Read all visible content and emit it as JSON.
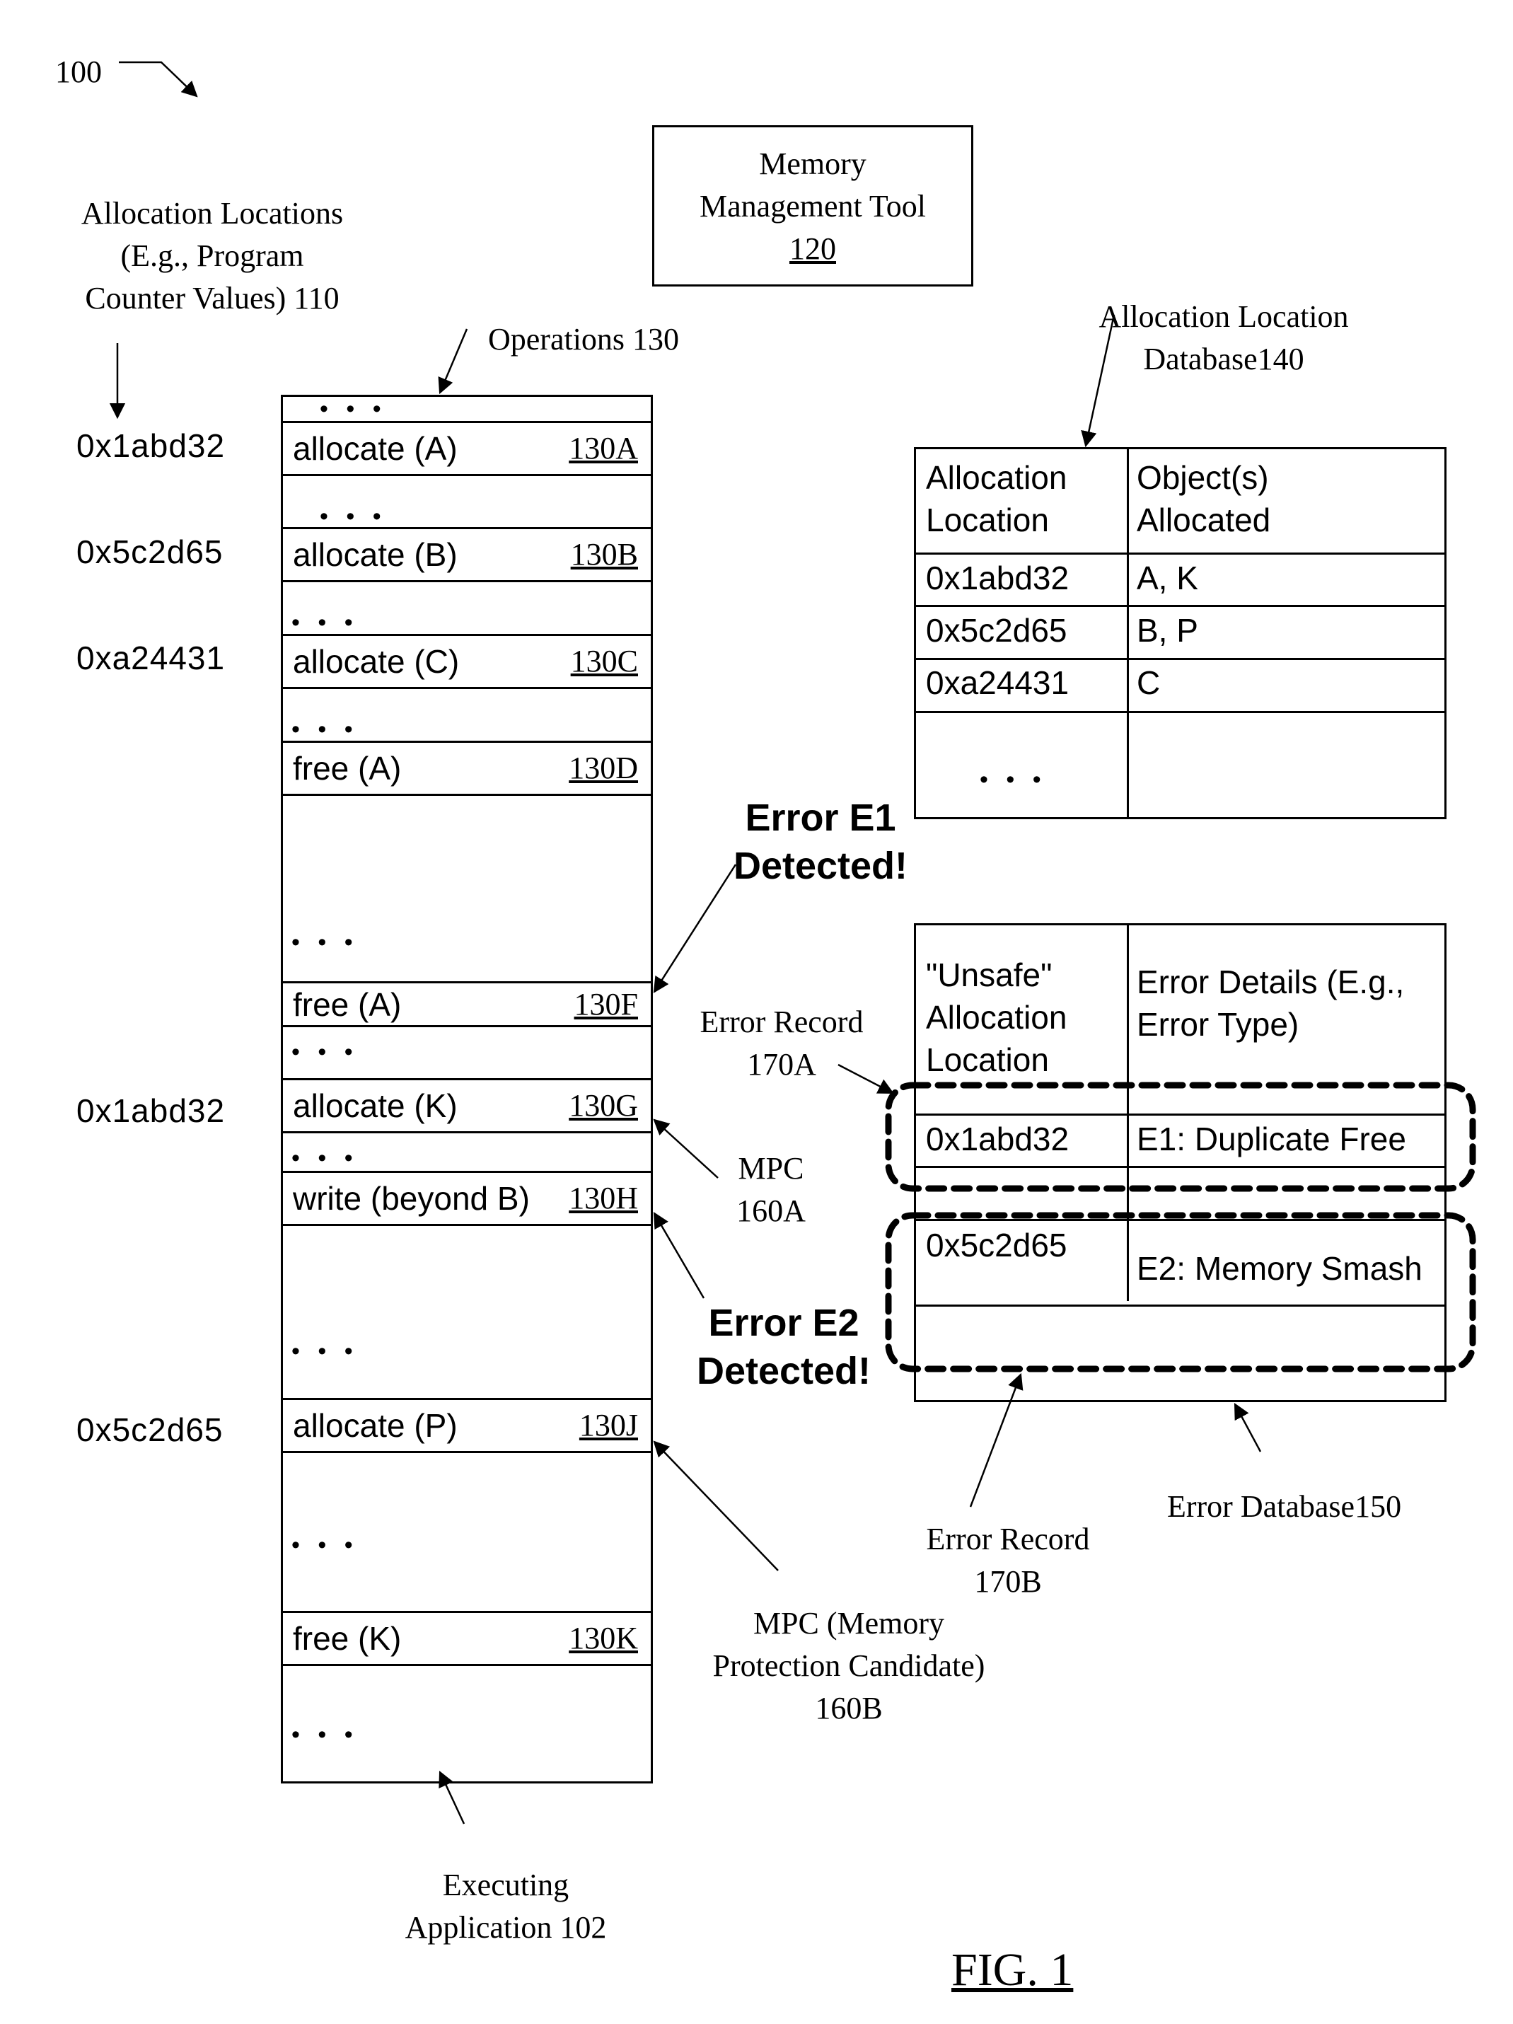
{
  "figure": {
    "ref_label": "100",
    "caption": "FIG. 1"
  },
  "allocation_locations": {
    "label_lines": [
      "Allocation Locations",
      "(E.g., Program",
      "Counter Values) 110"
    ],
    "addresses": [
      "0x1abd32",
      "0x5c2d65",
      "0xa24431",
      "0x1abd32",
      "0x5c2d65"
    ]
  },
  "memory_management_tool": {
    "line1": "Memory",
    "line2": "Management Tool",
    "ref": "120"
  },
  "operations": {
    "label": "Operations 130",
    "ellipsis": "• • •",
    "rows": [
      {
        "type": "dots"
      },
      {
        "type": "op",
        "text": "allocate (A)",
        "ref": "130A"
      },
      {
        "type": "dots"
      },
      {
        "type": "op",
        "text": "allocate (B)",
        "ref": "130B"
      },
      {
        "type": "dots"
      },
      {
        "type": "op",
        "text": "allocate (C)",
        "ref": "130C"
      },
      {
        "type": "dots"
      },
      {
        "type": "op",
        "text": "free (A)",
        "ref": "130D"
      },
      {
        "type": "dots"
      },
      {
        "type": "op",
        "text": "free (A)",
        "ref": "130F"
      },
      {
        "type": "dots"
      },
      {
        "type": "op",
        "text": "allocate (K)",
        "ref": "130G"
      },
      {
        "type": "dots"
      },
      {
        "type": "op",
        "text": "write (beyond B)",
        "ref": "130H"
      },
      {
        "type": "dots"
      },
      {
        "type": "op",
        "text": "allocate (P)",
        "ref": "130J"
      },
      {
        "type": "dots"
      },
      {
        "type": "op",
        "text": "free (K)",
        "ref": "130K"
      },
      {
        "type": "dots"
      }
    ]
  },
  "executing_application": {
    "line1": "Executing",
    "line2": "Application 102"
  },
  "allocation_location_database": {
    "label_line1": "Allocation Location",
    "label_line2": "Database140",
    "headers": [
      [
        "Allocation",
        "Location"
      ],
      [
        "Object(s)",
        "Allocated"
      ]
    ],
    "rows": [
      [
        "0x1abd32",
        "A, K"
      ],
      [
        "0x5c2d65",
        "B, P"
      ],
      [
        "0xa24431",
        "C"
      ]
    ],
    "ellipsis": "• • •"
  },
  "error_database": {
    "label": "Error Database150",
    "headers": [
      [
        "\"Unsafe\"",
        "Allocation",
        "Location"
      ],
      [
        "Error Details (E.g.,",
        "Error Type)"
      ]
    ],
    "rows": [
      [
        "0x1abd32",
        "E1: Duplicate Free"
      ],
      [
        "0x5c2d65",
        "E2: Memory Smash"
      ]
    ]
  },
  "annotations": {
    "error_e1": [
      "Error  E1",
      "Detected!"
    ],
    "error_e2": [
      "Error  E2",
      "Detected!"
    ],
    "error_record_170a": [
      "Error Record",
      "170A"
    ],
    "error_record_170b": [
      "Error Record",
      "170B"
    ],
    "mpc_160a": [
      "MPC",
      "160A"
    ],
    "mpc_160b": [
      "MPC (Memory",
      "Protection Candidate)",
      "160B"
    ]
  }
}
